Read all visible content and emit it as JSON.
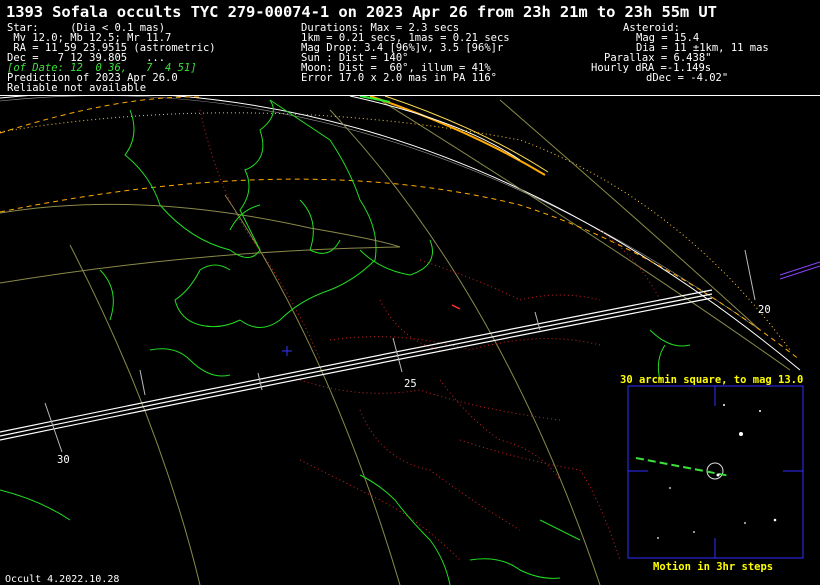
{
  "header": {
    "title": "1393 Sofala occults TYC 279-00074-1 on 2023 Apr 26 from 23h 21m to 23h 55m UT",
    "star": {
      "line1": "Star:     (Dia < 0.1 mas)",
      "line2": " Mv 12.0; Mb 12.5; Mr 11.7",
      "line3": " RA = 11 59 23.9515 (astrometric)",
      "line4": "Dec =   7 12 39.805   ...",
      "line5": "[of Date: 12  0 36,   7  4 51]",
      "line6": "Prediction of 2023 Apr 26.0",
      "line7": "Reliable not available"
    },
    "durations": {
      "line1": "Durations: Max = 2.3 secs",
      "line2": "1km = 0.21 secs, 1mas = 0.21 secs",
      "line3": "Mag Drop: 3.4 [96%]v, 3.5 [96%]r",
      "line4": "Sun : Dist = 140°",
      "line5": "Moon: Dist =  60°, illum = 41%",
      "line6": "Error 17.0 x 2.0 mas in PA 116°"
    },
    "asteroid": {
      "line1": "Asteroid:",
      "line2": "Mag = 15.4",
      "line3": "Dia = 11 ±1km, 11 mas",
      "line4": "Parallax = 6.438\"",
      "line5": "Hourly dRA =-1.149s",
      "line6": "dDec = -4.02\""
    }
  },
  "map": {
    "longitude_labels": [
      "30",
      "25",
      "20"
    ],
    "colors": {
      "coastline": "#22dd22",
      "borders": "#cc2222",
      "graticule": "#8a8a4a",
      "path": "#ffffff",
      "error_limits": "#ffaa00",
      "sun_rise": "#ffaa00"
    }
  },
  "starchart": {
    "title": "30 arcmin square, to mag 13.0",
    "caption": "Motion in 3hr steps",
    "frame_color": "#3030ff"
  },
  "footer": "Occult 4.2022.10.28"
}
